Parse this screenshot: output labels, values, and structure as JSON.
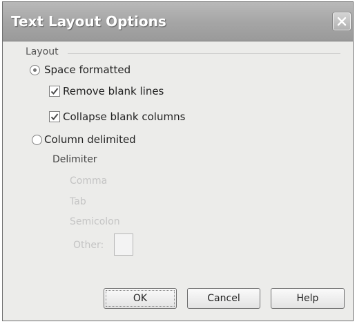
{
  "window": {
    "title": "Text Layout Options",
    "close_icon": "close-icon"
  },
  "layout": {
    "group_label": "Layout",
    "space_formatted": {
      "label": "Space formatted",
      "selected": true
    },
    "remove_blank_lines": {
      "label": "Remove blank lines",
      "checked": true
    },
    "collapse_blank_columns": {
      "label": "Collapse blank columns",
      "checked": true
    },
    "column_delimited": {
      "label": "Column delimited",
      "selected": false
    }
  },
  "delimiter": {
    "label": "Delimiter",
    "comma": "Comma",
    "tab": "Tab",
    "semicolon": "Semicolon",
    "other": "Other:",
    "other_value": ""
  },
  "buttons": {
    "ok": "OK",
    "cancel": "Cancel",
    "help": "Help"
  }
}
